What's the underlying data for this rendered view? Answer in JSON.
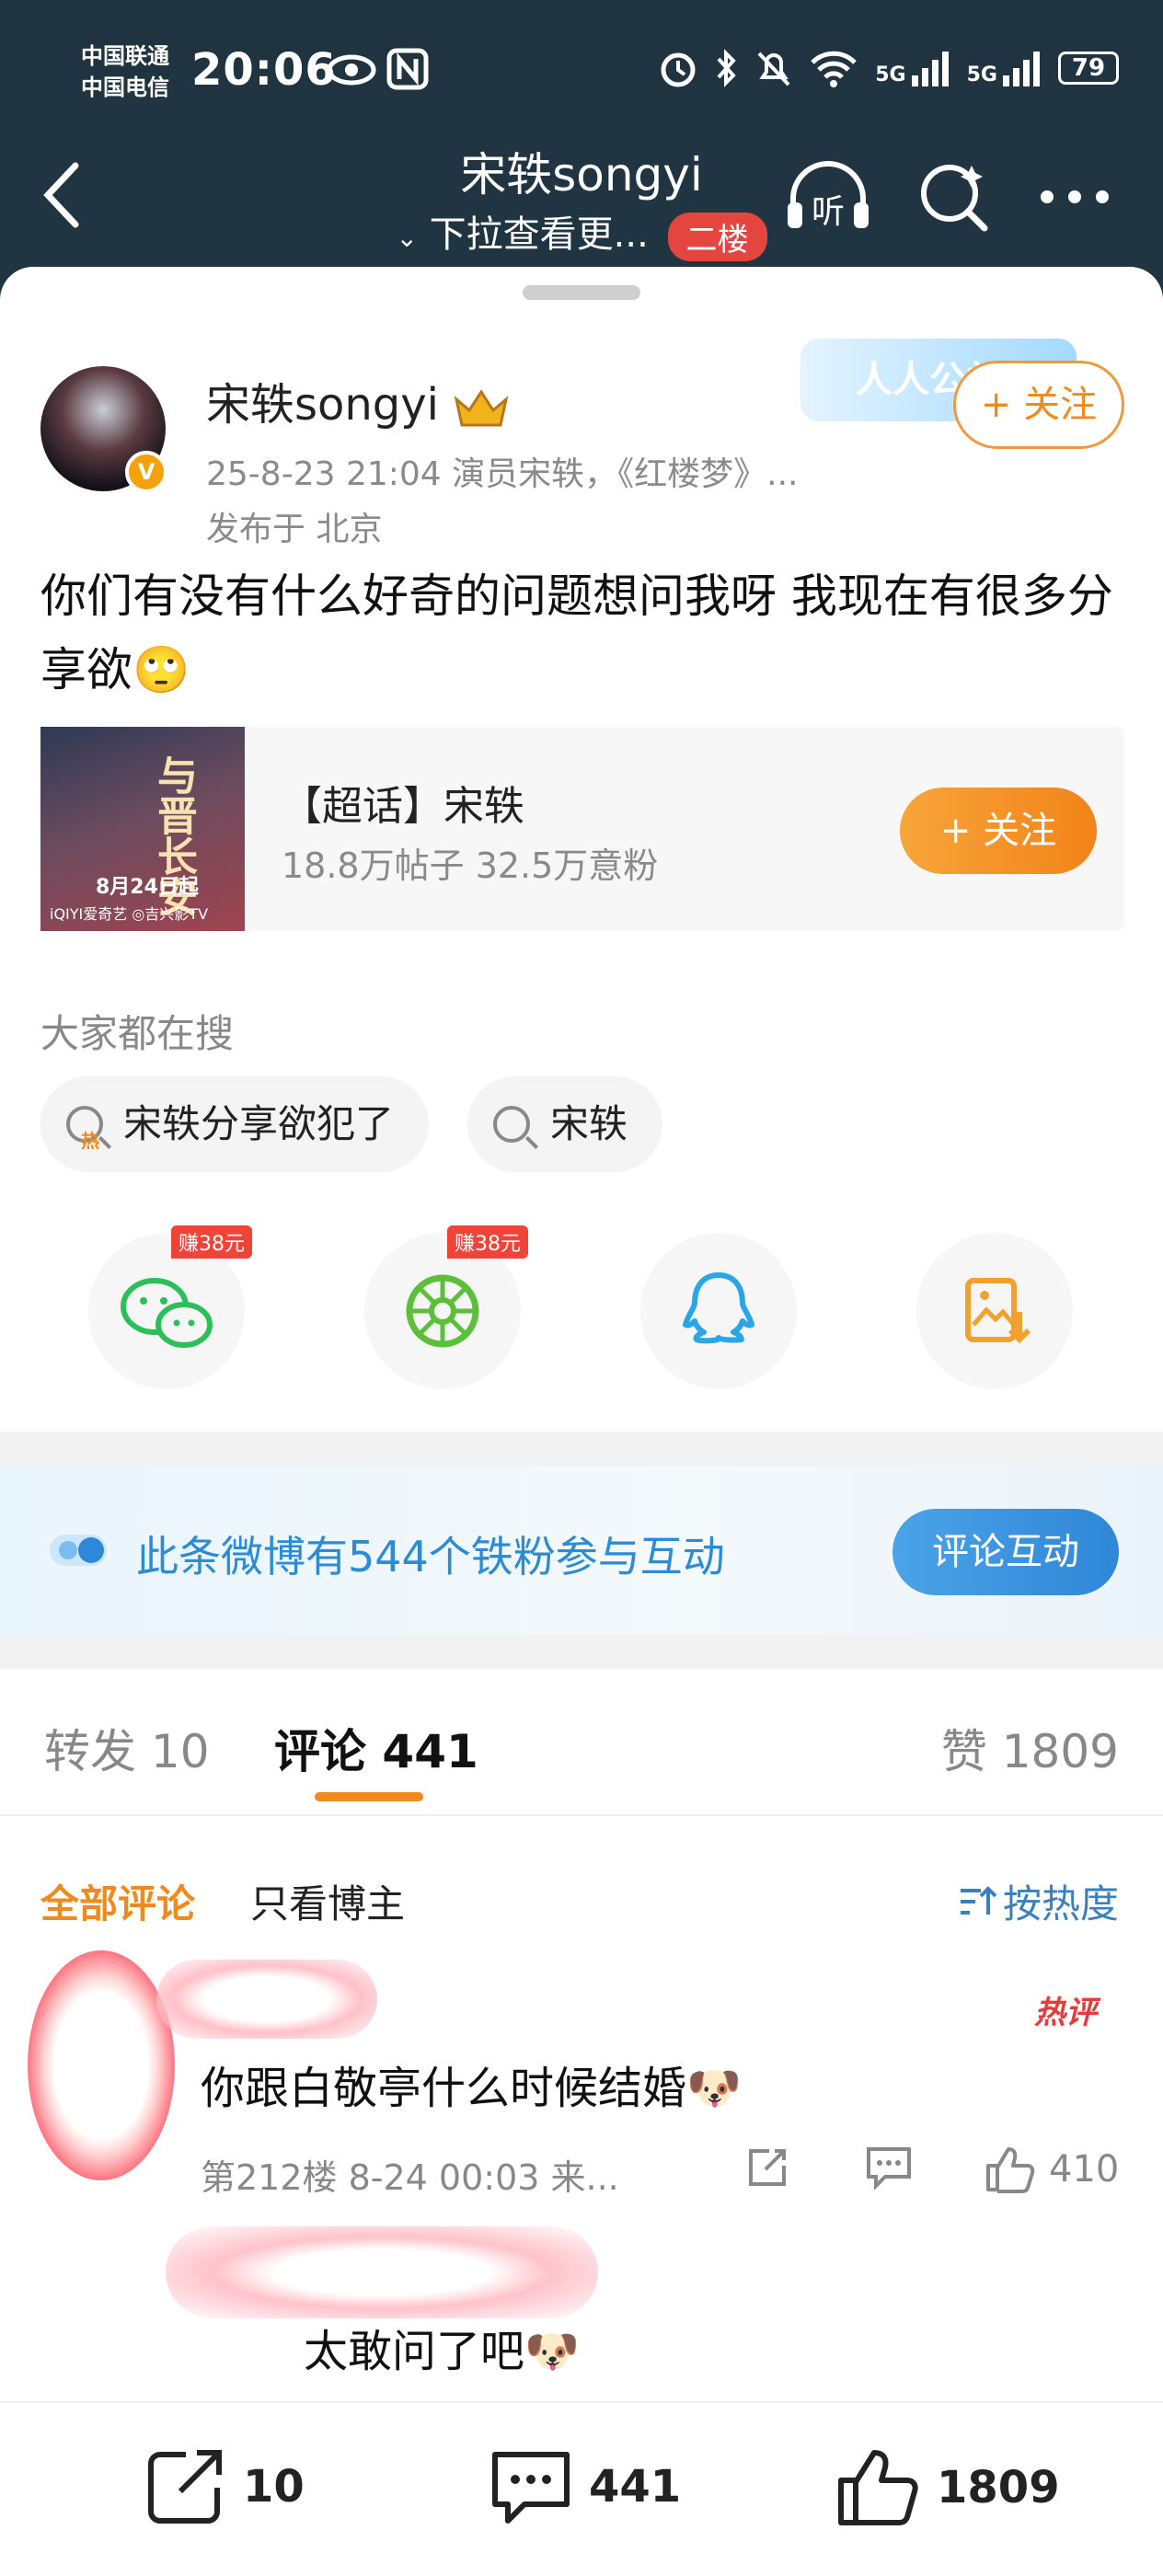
{
  "status_bar": {
    "carrier1": "中国联通",
    "carrier2": "中国电信",
    "time": "20:06",
    "net1": "5G",
    "net2": "5G",
    "battery": "79"
  },
  "nav": {
    "title": "宋轶songyi",
    "subtitle": "下拉查看更...",
    "floor_badge": "二楼",
    "listen_label": "听"
  },
  "post": {
    "author": "宋轶songyi",
    "meta": "25-8-23 21:04 演员宋轶，《红楼梦》...",
    "location": "发布于 北京",
    "follow_label": "+ 关注",
    "sticker_text": "人人公益",
    "content": "你们有没有什么好奇的问题想问我呀 我现在有很多分享欲🙄"
  },
  "super_topic": {
    "title": "【超话】宋轶",
    "stats": "18.8万帖子 32.5万意粉",
    "follow_label": "+ 关注",
    "poster_title": "与晋长安",
    "poster_date": "8月24日起",
    "poster_footer": "iQIYI爱奇艺  ◎吉兴影TV"
  },
  "search": {
    "title": "大家都在搜",
    "chips": [
      {
        "label": "宋轶分享欲犯了"
      },
      {
        "label": "宋轶"
      }
    ]
  },
  "share": {
    "reward1": "赚38元",
    "reward2": "赚38元"
  },
  "banner": {
    "text": "此条微博有544个铁粉参与互动",
    "button": "评论互动"
  },
  "tabs": {
    "repost_label": "转发",
    "repost_count": "10",
    "comment_label": "评论",
    "comment_count": "441",
    "like_label": "赞",
    "like_count": "1809"
  },
  "filters": {
    "all": "全部评论",
    "author_only": "只看博主",
    "sort": "按热度"
  },
  "comment": {
    "hot_label": "热评",
    "text": "你跟白敬亭什么时候结婚🐶",
    "meta": "第212楼 8-24 00:03 来...",
    "likes": "410",
    "reply_text": "太敢问了吧🐶"
  },
  "bottom_bar": {
    "repost": "10",
    "comment": "441",
    "like": "1809"
  }
}
